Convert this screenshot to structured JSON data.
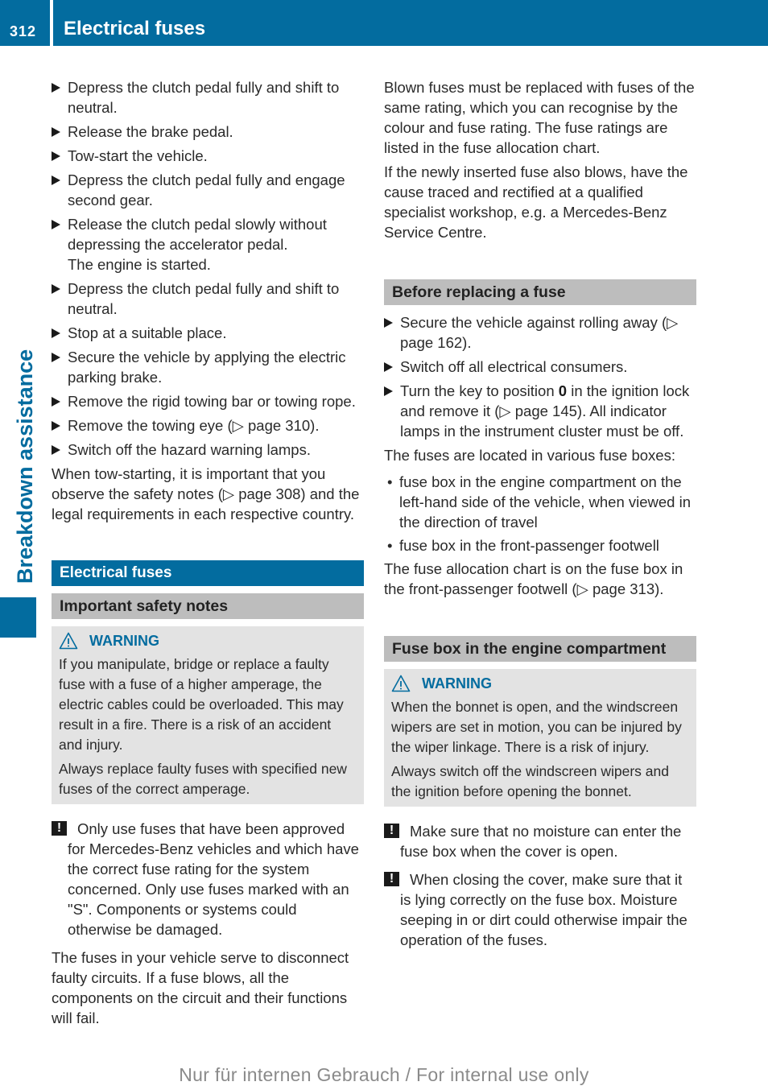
{
  "header": {
    "page_number": "312",
    "title": "Electrical fuses"
  },
  "sidebar": {
    "section_label": "Breakdown assistance"
  },
  "left_column": {
    "steps": [
      "Depress the clutch pedal fully and shift to neutral.",
      "Release the brake pedal.",
      "Tow-start the vehicle.",
      "Depress the clutch pedal fully and engage second gear.",
      "Release the clutch pedal slowly without depressing the accelerator pedal.",
      "Depress the clutch pedal fully and shift to neutral.",
      "Stop at a suitable place.",
      "Secure the vehicle by applying the electric parking brake.",
      "Remove the rigid towing bar or towing rope.",
      "Remove the towing eye (▷ page 310).",
      "Switch off the hazard warning lamps."
    ],
    "step5_result": "The engine is started.",
    "tow_start_note": "When tow-starting, it is important that you observe the safety notes (▷ page 308) and the legal requirements in each respective country.",
    "section_heading": "Electrical fuses",
    "subheading": "Important safety notes",
    "warning": {
      "label": "WARNING",
      "icon": "warning-triangle-icon",
      "paragraphs": [
        "If you manipulate, bridge or replace a faulty fuse with a fuse of a higher amperage, the electric cables could be overloaded. This may result in a fire. There is a risk of an accident and injury.",
        "Always replace faulty fuses with specified new fuses of the correct amperage."
      ]
    },
    "notice": {
      "icon": "exclamation-icon",
      "symbol": "!",
      "text": "Only use fuses that have been approved for Mercedes-Benz vehicles and which have the correct fuse rating for the system concerned. Only use fuses marked with an \"S\". Components or systems could otherwise be damaged."
    },
    "closing_para": "The fuses in your vehicle serve to disconnect faulty circuits. If a fuse blows, all the components on the circuit and their functions will fail."
  },
  "right_column": {
    "intro_paras": [
      "Blown fuses must be replaced with fuses of the same rating, which you can recognise by the colour and fuse rating. The fuse ratings are listed in the fuse allocation chart.",
      "If the newly inserted fuse also blows, have the cause traced and rectified at a qualified specialist workshop, e.g. a Mercedes-Benz Service Centre."
    ],
    "before_heading": "Before replacing a fuse",
    "before_steps": {
      "s1": "Secure the vehicle against rolling away (▷ page 162).",
      "s2": "Switch off all electrical consumers.",
      "s3_pre": "Turn the key to position ",
      "s3_key": "0",
      "s3_post": " in the ignition lock and remove it (▷ page 145). All indicator lamps in the instrument cluster must be off."
    },
    "locations_intro": "The fuses are located in various fuse boxes:",
    "locations": [
      "fuse box in the engine compartment on the left-hand side of the vehicle, when viewed in the direction of travel",
      "fuse box in the front-passenger footwell"
    ],
    "chart_note": "The fuse allocation chart is on the fuse box in the front-passenger footwell (▷ page 313).",
    "engine_heading": "Fuse box in the engine compartment",
    "warning": {
      "label": "WARNING",
      "icon": "warning-triangle-icon",
      "paragraphs": [
        "When the bonnet is open, and the windscreen wipers are set in motion, you can be injured by the wiper linkage. There is a risk of injury.",
        "Always switch off the windscreen wipers and the ignition before opening the bonnet."
      ]
    },
    "notices": [
      {
        "symbol": "!",
        "text": "Make sure that no moisture can enter the fuse box when the cover is open."
      },
      {
        "symbol": "!",
        "text": "When closing the cover, make sure that it is lying correctly on the fuse box. Moisture seeping in or dirt could otherwise impair the operation of the fuses."
      }
    ]
  },
  "footer": {
    "watermark": "Nur für internen Gebrauch / For internal use only"
  },
  "colors": {
    "brand_blue": "#036c9f",
    "subheading_gray": "#bdbdbd",
    "warning_bg": "#e3e3e3"
  }
}
